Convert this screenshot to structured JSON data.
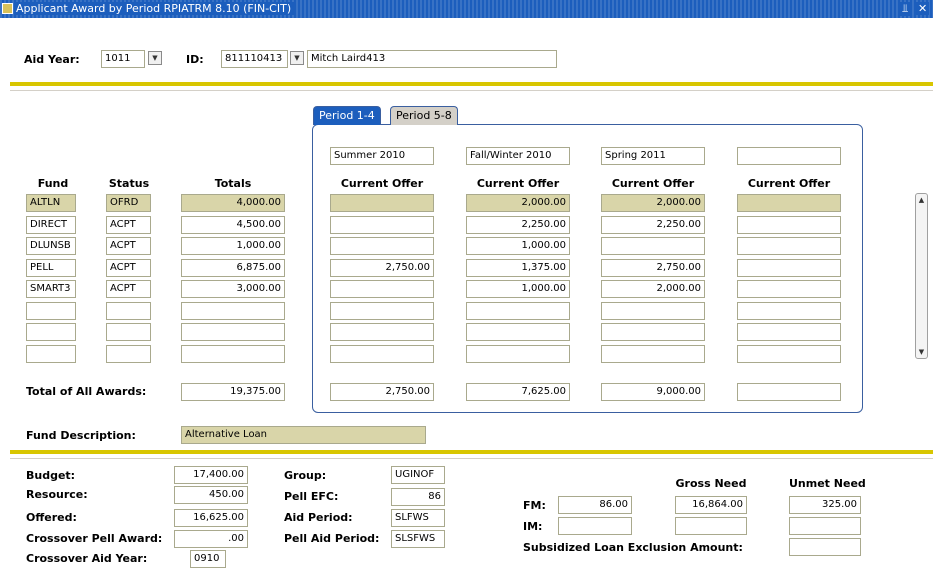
{
  "window": {
    "title": "Applicant Award by Period  RPIATRM  8.10  (FIN-CIT)",
    "ctrl_min": "⫫",
    "ctrl_close": "✕"
  },
  "key": {
    "aid_year_label": "Aid Year:",
    "aid_year": "1011",
    "id_label": "ID:",
    "id": "811110413",
    "name": "Mitch Laird413"
  },
  "tabs": [
    {
      "label": "Period 1-4"
    },
    {
      "label": "Period 5-8"
    }
  ],
  "periods": [
    "Summer 2010",
    "Fall/Winter 2010",
    "Spring 2011",
    ""
  ],
  "headers": {
    "fund": "Fund",
    "status": "Status",
    "totals": "Totals",
    "current_offer": "Current Offer"
  },
  "rows": [
    {
      "fund": "ALTLN",
      "status": "OFRD",
      "total": "4,000.00",
      "offers": [
        "",
        "2,000.00",
        "2,000.00",
        ""
      ]
    },
    {
      "fund": "DIRECT",
      "status": "ACPT",
      "total": "4,500.00",
      "offers": [
        "",
        "2,250.00",
        "2,250.00",
        ""
      ]
    },
    {
      "fund": "DLUNSB",
      "status": "ACPT",
      "total": "1,000.00",
      "offers": [
        "",
        "1,000.00",
        "",
        ""
      ]
    },
    {
      "fund": "PELL",
      "status": "ACPT",
      "total": "6,875.00",
      "offers": [
        "2,750.00",
        "1,375.00",
        "2,750.00",
        ""
      ]
    },
    {
      "fund": "SMART3",
      "status": "ACPT",
      "total": "3,000.00",
      "offers": [
        "",
        "1,000.00",
        "2,000.00",
        ""
      ]
    },
    {
      "fund": "",
      "status": "",
      "total": "",
      "offers": [
        "",
        "",
        "",
        ""
      ]
    },
    {
      "fund": "",
      "status": "",
      "total": "",
      "offers": [
        "",
        "",
        "",
        ""
      ]
    },
    {
      "fund": "",
      "status": "",
      "total": "",
      "offers": [
        "",
        "",
        "",
        ""
      ]
    }
  ],
  "total_all": {
    "label": "Total of All Awards:",
    "total": "19,375.00",
    "periods": [
      "2,750.00",
      "7,625.00",
      "9,000.00",
      ""
    ]
  },
  "fund_description": {
    "label": "Fund Description:",
    "value": "Alternative Loan"
  },
  "budget": {
    "budget_label": "Budget:",
    "budget": "17,400.00",
    "resource_label": "Resource:",
    "resource": "450.00",
    "offered_label": "Offered:",
    "offered": "16,625.00",
    "crossover_pell_label": "Crossover Pell Award:",
    "crossover_pell": ".00",
    "crossover_year_label": "Crossover Aid Year:",
    "crossover_year": "0910",
    "group_label": "Group:",
    "group": "UGINOF",
    "pell_efc_label": "Pell EFC:",
    "pell_efc": "86",
    "aid_period_label": "Aid Period:",
    "aid_period": "SLFWS",
    "pell_aid_period_label": "Pell Aid Period:",
    "pell_aid_period": "SLSFWS",
    "gross_need_label": "Gross Need",
    "unmet_need_label": "Unmet Need",
    "fm_label": "FM:",
    "fm_efc": "86.00",
    "fm_gross": "16,864.00",
    "fm_unmet": "325.00",
    "im_label": "IM:",
    "im_efc": "",
    "im_gross": "",
    "im_unmet": "",
    "sub_loan_label": "Subsidized Loan Exclusion Amount:",
    "sub_loan": ""
  },
  "colors": {
    "titlebar": "#1c5ebd",
    "separator": "#d8c600",
    "selected_field": "#d9d5a9",
    "tab_border": "#3a5fa0"
  },
  "icons": {
    "app": "app-icon",
    "dropdown": "dropdown-arrow-icon",
    "scroll_up": "scroll-up-icon",
    "scroll_down": "scroll-down-icon"
  }
}
